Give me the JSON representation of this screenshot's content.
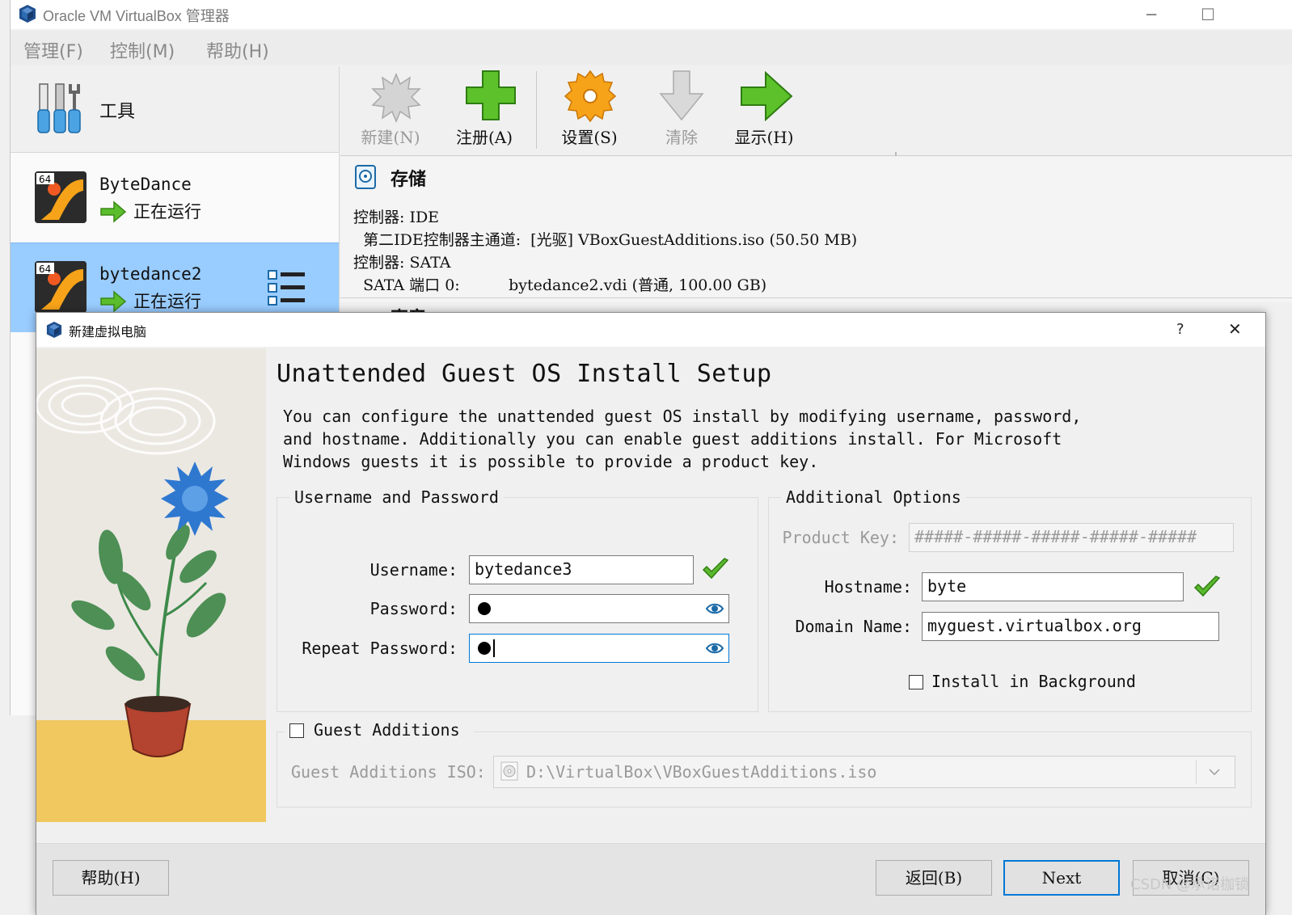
{
  "window": {
    "title": "Oracle VM VirtualBox 管理器",
    "controls": {
      "minimize": "─",
      "maximize": "☐"
    }
  },
  "menu": [
    "管理(F)",
    "控制(M)",
    "帮助(H)"
  ],
  "sidebar": {
    "tools_label": "工具",
    "vms": [
      {
        "name": "ByteDance",
        "status": "正在运行",
        "badge": "64"
      },
      {
        "name": "bytedance2",
        "status": "正在运行",
        "badge": "64"
      }
    ]
  },
  "toolbar": {
    "new": "新建(N)",
    "register": "注册(A)",
    "settings": "设置(S)",
    "discard": "清除",
    "show": "显示(H)"
  },
  "details": {
    "section_title": "存储",
    "lines": [
      "控制器: IDE",
      "  第二IDE控制器主通道:  [光驱] VBoxGuestAdditions.iso (50.50 MB)",
      "控制器: SATA",
      "  SATA 端口 0:          bytedance2.vdi (普通, 100.00 GB)"
    ],
    "next_section_partial": "声音"
  },
  "dialog": {
    "title": "新建虚拟电脑",
    "help_btn": "?",
    "close_btn": "✕",
    "heading": "Unattended Guest OS Install Setup",
    "description": "You can configure the unattended guest OS install by modifying username, password, and hostname. Additionally you can enable guest additions install. For Microsoft Windows guests it is possible to provide a product key.",
    "userpass": {
      "group_title": "Username and Password",
      "username_label": "Username:",
      "username_value": "bytedance3",
      "password_label": "Password:",
      "repeat_label": "Repeat Password:"
    },
    "additional": {
      "group_title": "Additional Options",
      "product_key_label": "Product Key:",
      "product_key_placeholder": "#####-#####-#####-#####-#####",
      "hostname_label": "Hostname:",
      "hostname_value": "byte",
      "domain_label": "Domain Name:",
      "domain_value": "myguest.virtualbox.org",
      "install_bg_label": "Install in Background"
    },
    "guest_additions": {
      "label": "Guest Additions",
      "iso_label": "Guest Additions ISO:",
      "iso_value": "D:\\VirtualBox\\VBoxGuestAdditions.iso"
    },
    "buttons": {
      "help": "帮助(H)",
      "back": "返回(B)",
      "next": "Next",
      "cancel": "取消(C)"
    }
  },
  "watermark": "CSDN @承诺枷锁",
  "colors": {
    "selection": "#99ccff",
    "accent": "#0078d7",
    "check_green": "#5ab82e"
  }
}
